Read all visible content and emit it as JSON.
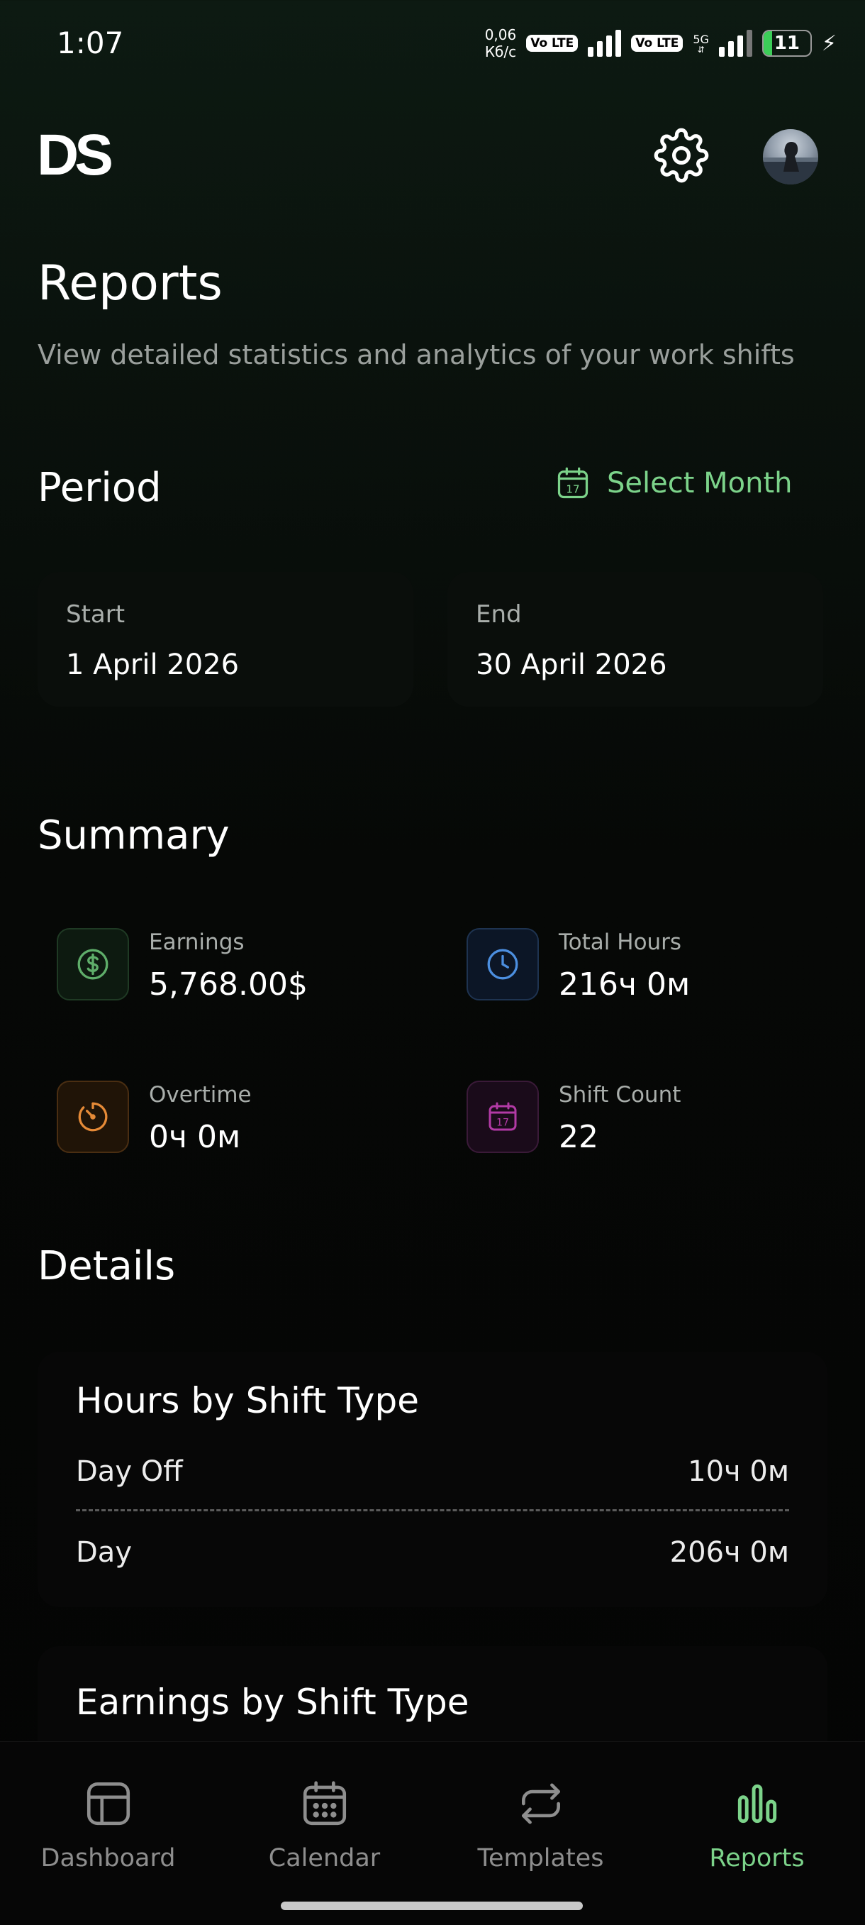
{
  "status_bar": {
    "time": "1:07",
    "speed_value": "0,06",
    "speed_unit": "Кб/с",
    "volte_label_1": "Vo LTE",
    "volte_label_2": "Vo LTE",
    "network_type": "5G",
    "battery_level": "11"
  },
  "header": {
    "logo": "DS",
    "settings_icon": "gear-icon",
    "avatar": "user-avatar"
  },
  "page": {
    "title": "Reports",
    "subtitle": "View detailed statistics and analytics of your work shifts"
  },
  "period": {
    "title": "Period",
    "select_month_label": "Select Month",
    "calendar_day": "17",
    "start_label": "Start",
    "start_value": "1 April 2026",
    "end_label": "End",
    "end_value": "30 April 2026"
  },
  "summary": {
    "title": "Summary",
    "earnings_label": "Earnings",
    "earnings_value": "5,768.00$",
    "total_hours_label": "Total Hours",
    "total_hours_value": "216ч 0м",
    "overtime_label": "Overtime",
    "overtime_value": "0ч 0м",
    "shift_count_label": "Shift Count",
    "shift_count_value": "22",
    "shift_icon_day": "17"
  },
  "details": {
    "title": "Details",
    "hours_card_title": "Hours by Shift Type",
    "hours_rows": [
      {
        "type": "Day Off",
        "value": "10ч 0м"
      },
      {
        "type": "Day",
        "value": "206ч 0м"
      }
    ],
    "earnings_card_title": "Earnings by Shift Type"
  },
  "nav": {
    "items": [
      {
        "label": "Dashboard",
        "icon": "dashboard-icon"
      },
      {
        "label": "Calendar",
        "icon": "calendar-icon"
      },
      {
        "label": "Templates",
        "icon": "repeat-icon"
      },
      {
        "label": "Reports",
        "icon": "bar-chart-icon"
      }
    ],
    "active_color": "#7cd38a"
  },
  "colors": {
    "accent_green": "#7cd38a",
    "earnings_icon": "#5fae6a",
    "hours_icon": "#4c8fe0",
    "overtime_icon": "#e58a37",
    "shift_icon": "#b23aa5"
  }
}
